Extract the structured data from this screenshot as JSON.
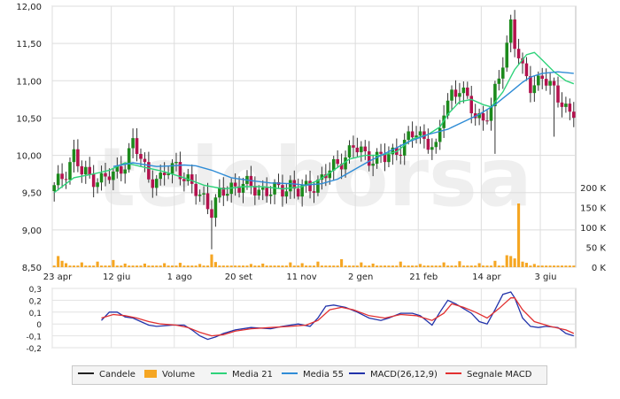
{
  "chart_data": [
    {
      "type": "candlestick",
      "panel": "price",
      "ylim": [
        8.5,
        12.0
      ],
      "y_ticks": [
        "8,50",
        "9,00",
        "9,50",
        "10,00",
        "10,50",
        "11,00",
        "11,50",
        "12,00"
      ],
      "x_ticks": [
        "23 apr",
        "12 giu",
        "1 ago",
        "20 set",
        "11 nov",
        "2 gen",
        "21 feb",
        "14 apr",
        "3 giu"
      ],
      "grid": true,
      "watermark": "teleborsa",
      "colors": {
        "up": "#1c8a1c",
        "down": "#b3124e",
        "wick": "#333333"
      },
      "price_path": [
        [
          0,
          9.55
        ],
        [
          3,
          9.8
        ],
        [
          5,
          10.02
        ],
        [
          7,
          9.75
        ],
        [
          12,
          9.68
        ],
        [
          15,
          9.72
        ],
        [
          18,
          9.92
        ],
        [
          20,
          10.15
        ],
        [
          22,
          9.95
        ],
        [
          24,
          9.72
        ],
        [
          27,
          9.65
        ],
        [
          29,
          9.8
        ],
        [
          31,
          9.9
        ],
        [
          33,
          9.7
        ],
        [
          35,
          9.55
        ],
        [
          38,
          9.45
        ],
        [
          40,
          9.25
        ],
        [
          42,
          9.45
        ],
        [
          45,
          9.6
        ],
        [
          50,
          9.58
        ],
        [
          55,
          9.5
        ],
        [
          58,
          9.55
        ],
        [
          60,
          9.62
        ],
        [
          62,
          9.5
        ],
        [
          64,
          9.55
        ],
        [
          67,
          9.65
        ],
        [
          70,
          9.78
        ],
        [
          73,
          9.95
        ],
        [
          76,
          10.1
        ],
        [
          80,
          9.98
        ],
        [
          84,
          9.95
        ],
        [
          88,
          10.12
        ],
        [
          92,
          10.3
        ],
        [
          95,
          10.2
        ],
        [
          97,
          10.05
        ],
        [
          99,
          10.6
        ],
        [
          101,
          10.85
        ],
        [
          103,
          10.9
        ],
        [
          105,
          10.7
        ],
        [
          107,
          10.55
        ],
        [
          109,
          10.5
        ],
        [
          111,
          10.6
        ],
        [
          113,
          11.05
        ],
        [
          115,
          11.5
        ],
        [
          116,
          11.8
        ],
        [
          117,
          11.5
        ],
        [
          119,
          11.1
        ],
        [
          121,
          10.95
        ],
        [
          124,
          11.05
        ],
        [
          126,
          10.9
        ],
        [
          128,
          10.8
        ],
        [
          129,
          10.75
        ],
        [
          130,
          10.65
        ],
        [
          131,
          10.55
        ]
      ],
      "series": [
        {
          "name": "Media 21",
          "color": "#2ed37a",
          "values": [
            [
              0,
              9.5
            ],
            [
              5,
              9.7
            ],
            [
              10,
              9.75
            ],
            [
              14,
              9.8
            ],
            [
              18,
              9.9
            ],
            [
              22,
              9.85
            ],
            [
              28,
              9.78
            ],
            [
              33,
              9.7
            ],
            [
              38,
              9.6
            ],
            [
              43,
              9.55
            ],
            [
              48,
              9.58
            ],
            [
              53,
              9.58
            ],
            [
              58,
              9.55
            ],
            [
              63,
              9.58
            ],
            [
              67,
              9.66
            ],
            [
              71,
              9.8
            ],
            [
              75,
              9.95
            ],
            [
              79,
              10.0
            ],
            [
              83,
              10.0
            ],
            [
              87,
              10.05
            ],
            [
              91,
              10.22
            ],
            [
              95,
              10.28
            ],
            [
              98,
              10.38
            ],
            [
              100,
              10.55
            ],
            [
              103,
              10.72
            ],
            [
              106,
              10.75
            ],
            [
              109,
              10.68
            ],
            [
              111,
              10.65
            ],
            [
              114,
              10.85
            ],
            [
              117,
              11.15
            ],
            [
              120,
              11.35
            ],
            [
              122,
              11.38
            ],
            [
              124,
              11.28
            ],
            [
              127,
              11.12
            ],
            [
              130,
              11.0
            ],
            [
              132,
              10.96
            ]
          ]
        },
        {
          "name": "Media 55",
          "color": "#2f8cd6",
          "values": [
            [
              15,
              9.85
            ],
            [
              20,
              9.9
            ],
            [
              26,
              9.85
            ],
            [
              30,
              9.86
            ],
            [
              33,
              9.87
            ],
            [
              36,
              9.86
            ],
            [
              40,
              9.8
            ],
            [
              45,
              9.7
            ],
            [
              50,
              9.66
            ],
            [
              55,
              9.63
            ],
            [
              60,
              9.62
            ],
            [
              64,
              9.6
            ],
            [
              68,
              9.62
            ],
            [
              72,
              9.68
            ],
            [
              76,
              9.8
            ],
            [
              80,
              9.92
            ],
            [
              85,
              10.05
            ],
            [
              90,
              10.18
            ],
            [
              95,
              10.28
            ],
            [
              100,
              10.35
            ],
            [
              104,
              10.45
            ],
            [
              108,
              10.55
            ],
            [
              112,
              10.68
            ],
            [
              116,
              10.85
            ],
            [
              119,
              10.98
            ],
            [
              121,
              11.05
            ],
            [
              124,
              11.1
            ],
            [
              128,
              11.12
            ],
            [
              132,
              11.1
            ]
          ]
        }
      ]
    },
    {
      "type": "bar",
      "panel": "volume",
      "name": "Volume",
      "color": "#f5a623",
      "ylim": [
        0,
        200000
      ],
      "y_ticks": [
        "0 K",
        "50 K",
        "100 K",
        "150 K",
        "200 K"
      ],
      "spikes": [
        [
          1,
          28000
        ],
        [
          2,
          16000
        ],
        [
          3,
          10000
        ],
        [
          7,
          12000
        ],
        [
          11,
          14000
        ],
        [
          15,
          18000
        ],
        [
          18,
          9000
        ],
        [
          23,
          9000
        ],
        [
          28,
          10000
        ],
        [
          32,
          11000
        ],
        [
          37,
          8000
        ],
        [
          40,
          32000
        ],
        [
          41,
          13000
        ],
        [
          50,
          8000
        ],
        [
          53,
          9000
        ],
        [
          60,
          12000
        ],
        [
          63,
          10000
        ],
        [
          67,
          14000
        ],
        [
          73,
          20000
        ],
        [
          78,
          12000
        ],
        [
          81,
          9000
        ],
        [
          88,
          14000
        ],
        [
          93,
          8000
        ],
        [
          99,
          12000
        ],
        [
          103,
          15000
        ],
        [
          108,
          10000
        ],
        [
          112,
          16000
        ],
        [
          115,
          30000
        ],
        [
          116,
          28000
        ],
        [
          117,
          22000
        ],
        [
          118,
          160000
        ],
        [
          119,
          14000
        ],
        [
          120,
          11000
        ],
        [
          122,
          8000
        ]
      ],
      "baseline_value": 4000
    },
    {
      "type": "line",
      "panel": "macd",
      "ylim": [
        -0.2,
        0.3
      ],
      "y_ticks": [
        "-0,2",
        "-0,1",
        "0",
        "0,1",
        "0,2",
        "0,3"
      ],
      "series": [
        {
          "name": "MACD(26,12,9)",
          "color": "#2233aa",
          "values": [
            [
              12,
              0.03
            ],
            [
              14,
              0.1
            ],
            [
              16,
              0.1
            ],
            [
              18,
              0.06
            ],
            [
              20,
              0.05
            ],
            [
              22,
              0.02
            ],
            [
              24,
              -0.01
            ],
            [
              26,
              -0.02
            ],
            [
              30,
              -0.01
            ],
            [
              33,
              -0.01
            ],
            [
              35,
              -0.05
            ],
            [
              37,
              -0.1
            ],
            [
              39,
              -0.13
            ],
            [
              41,
              -0.11
            ],
            [
              43,
              -0.08
            ],
            [
              46,
              -0.05
            ],
            [
              50,
              -0.03
            ],
            [
              55,
              -0.04
            ],
            [
              58,
              -0.02
            ],
            [
              62,
              0.0
            ],
            [
              65,
              -0.02
            ],
            [
              67,
              0.05
            ],
            [
              69,
              0.15
            ],
            [
              71,
              0.16
            ],
            [
              74,
              0.14
            ],
            [
              77,
              0.1
            ],
            [
              80,
              0.05
            ],
            [
              83,
              0.03
            ],
            [
              85,
              0.05
            ],
            [
              88,
              0.09
            ],
            [
              91,
              0.09
            ],
            [
              93,
              0.07
            ],
            [
              96,
              -0.01
            ],
            [
              98,
              0.1
            ],
            [
              100,
              0.2
            ],
            [
              102,
              0.17
            ],
            [
              104,
              0.13
            ],
            [
              106,
              0.09
            ],
            [
              108,
              0.02
            ],
            [
              110,
              0.0
            ],
            [
              112,
              0.12
            ],
            [
              114,
              0.25
            ],
            [
              116,
              0.27
            ],
            [
              117,
              0.22
            ],
            [
              119,
              0.05
            ],
            [
              121,
              -0.02
            ],
            [
              123,
              -0.03
            ],
            [
              125,
              -0.02
            ],
            [
              128,
              -0.03
            ],
            [
              130,
              -0.08
            ],
            [
              132,
              -0.1
            ]
          ]
        },
        {
          "name": "Segnale MACD",
          "color": "#e23030",
          "values": [
            [
              12,
              0.05
            ],
            [
              15,
              0.08
            ],
            [
              18,
              0.07
            ],
            [
              21,
              0.05
            ],
            [
              24,
              0.02
            ],
            [
              27,
              0.0
            ],
            [
              31,
              -0.01
            ],
            [
              34,
              -0.03
            ],
            [
              37,
              -0.07
            ],
            [
              40,
              -0.1
            ],
            [
              43,
              -0.09
            ],
            [
              46,
              -0.06
            ],
            [
              50,
              -0.04
            ],
            [
              55,
              -0.03
            ],
            [
              60,
              -0.02
            ],
            [
              64,
              -0.01
            ],
            [
              67,
              0.03
            ],
            [
              70,
              0.12
            ],
            [
              73,
              0.14
            ],
            [
              76,
              0.12
            ],
            [
              80,
              0.07
            ],
            [
              84,
              0.05
            ],
            [
              88,
              0.08
            ],
            [
              92,
              0.07
            ],
            [
              96,
              0.03
            ],
            [
              99,
              0.09
            ],
            [
              101,
              0.17
            ],
            [
              104,
              0.14
            ],
            [
              107,
              0.1
            ],
            [
              110,
              0.05
            ],
            [
              113,
              0.13
            ],
            [
              116,
              0.22
            ],
            [
              117,
              0.22
            ],
            [
              119,
              0.12
            ],
            [
              122,
              0.02
            ],
            [
              126,
              -0.02
            ],
            [
              130,
              -0.05
            ],
            [
              132,
              -0.08
            ]
          ]
        }
      ]
    }
  ],
  "legend": [
    {
      "label": "Candele",
      "color": "#222222",
      "kind": "line"
    },
    {
      "label": "Volume",
      "color": "#f5a623",
      "kind": "bar"
    },
    {
      "label": "Media 21",
      "color": "#2ed37a",
      "kind": "line"
    },
    {
      "label": "Media 55",
      "color": "#2f8cd6",
      "kind": "line"
    },
    {
      "label": "MACD(26,12,9)",
      "color": "#2233aa",
      "kind": "line"
    },
    {
      "label": "Segnale MACD",
      "color": "#e23030",
      "kind": "line"
    }
  ]
}
